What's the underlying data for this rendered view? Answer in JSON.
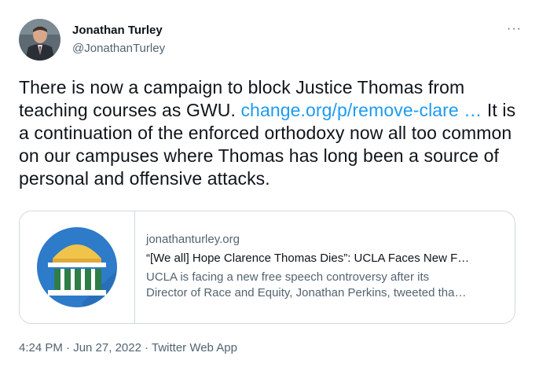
{
  "author": {
    "name": "Jonathan Turley",
    "handle": "@JonathanTurley"
  },
  "menu": {
    "more_label": "···",
    "more_icon": "more-horizontal-icon"
  },
  "tweet": {
    "text_part1": "There is now a campaign to block Justice Thomas from teaching courses as GWU. ",
    "link_text": "change.org/p/remove-clare …",
    "text_part2": " It is a continuation of the enforced orthodoxy now all too common on our campuses where Thomas has long been a source of personal and offensive attacks."
  },
  "card": {
    "domain": "jonathanturley.org",
    "title": "“[We all] Hope Clarence Thomas Dies”: UCLA Faces New F…",
    "description_line1": "UCLA is facing a new free speech controversy after its",
    "description_line2": "Director of Race and Equity, Jonathan Perkins, tweeted tha…",
    "thumbnail_icon": "building-columns-icon"
  },
  "meta": {
    "timestamp": "4:24 PM · Jun 27, 2022 · Twitter Web App"
  },
  "colors": {
    "link": "#1d9bf0",
    "text": "#0f1419",
    "secondary": "#536471",
    "border": "#cfd9de",
    "thumb_circle": "#2d7bc9",
    "dome": "#f0c44a",
    "columns": "#2e7d46"
  }
}
